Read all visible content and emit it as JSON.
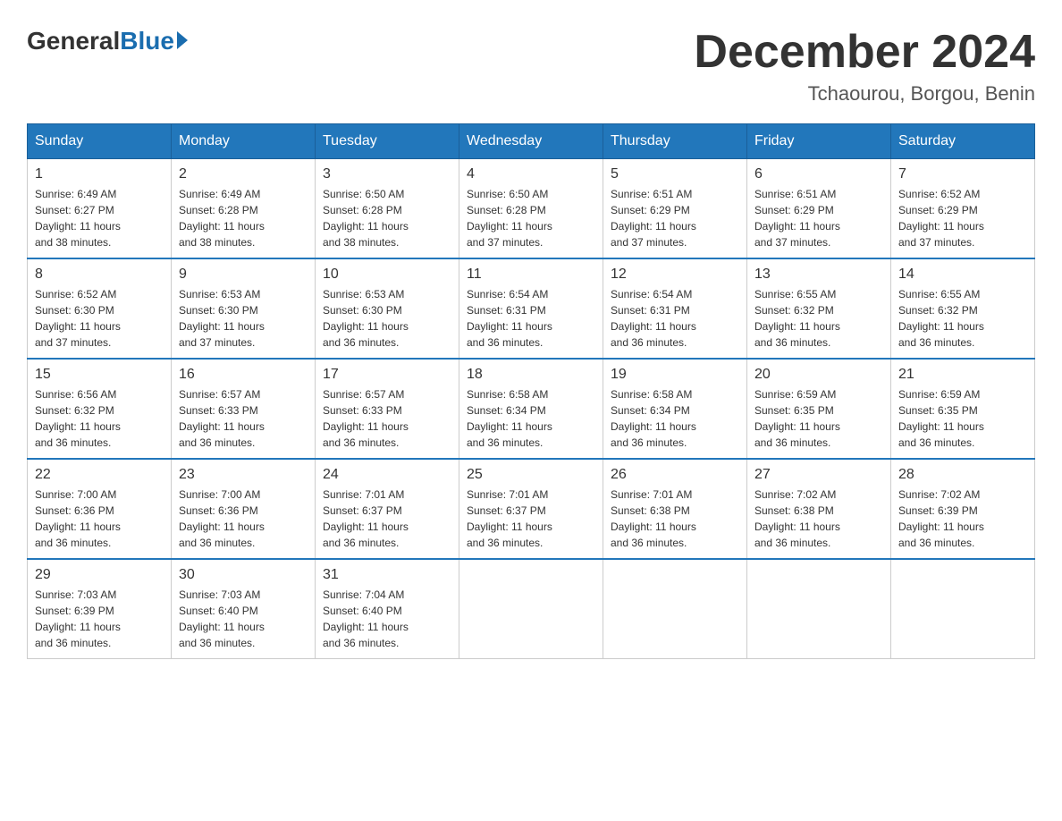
{
  "logo": {
    "general": "General",
    "blue": "Blue"
  },
  "title": "December 2024",
  "location": "Tchaourou, Borgou, Benin",
  "weekdays": [
    "Sunday",
    "Monday",
    "Tuesday",
    "Wednesday",
    "Thursday",
    "Friday",
    "Saturday"
  ],
  "weeks": [
    [
      {
        "day": "1",
        "sunrise": "6:49 AM",
        "sunset": "6:27 PM",
        "daylight": "11 hours and 38 minutes."
      },
      {
        "day": "2",
        "sunrise": "6:49 AM",
        "sunset": "6:28 PM",
        "daylight": "11 hours and 38 minutes."
      },
      {
        "day": "3",
        "sunrise": "6:50 AM",
        "sunset": "6:28 PM",
        "daylight": "11 hours and 38 minutes."
      },
      {
        "day": "4",
        "sunrise": "6:50 AM",
        "sunset": "6:28 PM",
        "daylight": "11 hours and 37 minutes."
      },
      {
        "day": "5",
        "sunrise": "6:51 AM",
        "sunset": "6:29 PM",
        "daylight": "11 hours and 37 minutes."
      },
      {
        "day": "6",
        "sunrise": "6:51 AM",
        "sunset": "6:29 PM",
        "daylight": "11 hours and 37 minutes."
      },
      {
        "day": "7",
        "sunrise": "6:52 AM",
        "sunset": "6:29 PM",
        "daylight": "11 hours and 37 minutes."
      }
    ],
    [
      {
        "day": "8",
        "sunrise": "6:52 AM",
        "sunset": "6:30 PM",
        "daylight": "11 hours and 37 minutes."
      },
      {
        "day": "9",
        "sunrise": "6:53 AM",
        "sunset": "6:30 PM",
        "daylight": "11 hours and 37 minutes."
      },
      {
        "day": "10",
        "sunrise": "6:53 AM",
        "sunset": "6:30 PM",
        "daylight": "11 hours and 36 minutes."
      },
      {
        "day": "11",
        "sunrise": "6:54 AM",
        "sunset": "6:31 PM",
        "daylight": "11 hours and 36 minutes."
      },
      {
        "day": "12",
        "sunrise": "6:54 AM",
        "sunset": "6:31 PM",
        "daylight": "11 hours and 36 minutes."
      },
      {
        "day": "13",
        "sunrise": "6:55 AM",
        "sunset": "6:32 PM",
        "daylight": "11 hours and 36 minutes."
      },
      {
        "day": "14",
        "sunrise": "6:55 AM",
        "sunset": "6:32 PM",
        "daylight": "11 hours and 36 minutes."
      }
    ],
    [
      {
        "day": "15",
        "sunrise": "6:56 AM",
        "sunset": "6:32 PM",
        "daylight": "11 hours and 36 minutes."
      },
      {
        "day": "16",
        "sunrise": "6:57 AM",
        "sunset": "6:33 PM",
        "daylight": "11 hours and 36 minutes."
      },
      {
        "day": "17",
        "sunrise": "6:57 AM",
        "sunset": "6:33 PM",
        "daylight": "11 hours and 36 minutes."
      },
      {
        "day": "18",
        "sunrise": "6:58 AM",
        "sunset": "6:34 PM",
        "daylight": "11 hours and 36 minutes."
      },
      {
        "day": "19",
        "sunrise": "6:58 AM",
        "sunset": "6:34 PM",
        "daylight": "11 hours and 36 minutes."
      },
      {
        "day": "20",
        "sunrise": "6:59 AM",
        "sunset": "6:35 PM",
        "daylight": "11 hours and 36 minutes."
      },
      {
        "day": "21",
        "sunrise": "6:59 AM",
        "sunset": "6:35 PM",
        "daylight": "11 hours and 36 minutes."
      }
    ],
    [
      {
        "day": "22",
        "sunrise": "7:00 AM",
        "sunset": "6:36 PM",
        "daylight": "11 hours and 36 minutes."
      },
      {
        "day": "23",
        "sunrise": "7:00 AM",
        "sunset": "6:36 PM",
        "daylight": "11 hours and 36 minutes."
      },
      {
        "day": "24",
        "sunrise": "7:01 AM",
        "sunset": "6:37 PM",
        "daylight": "11 hours and 36 minutes."
      },
      {
        "day": "25",
        "sunrise": "7:01 AM",
        "sunset": "6:37 PM",
        "daylight": "11 hours and 36 minutes."
      },
      {
        "day": "26",
        "sunrise": "7:01 AM",
        "sunset": "6:38 PM",
        "daylight": "11 hours and 36 minutes."
      },
      {
        "day": "27",
        "sunrise": "7:02 AM",
        "sunset": "6:38 PM",
        "daylight": "11 hours and 36 minutes."
      },
      {
        "day": "28",
        "sunrise": "7:02 AM",
        "sunset": "6:39 PM",
        "daylight": "11 hours and 36 minutes."
      }
    ],
    [
      {
        "day": "29",
        "sunrise": "7:03 AM",
        "sunset": "6:39 PM",
        "daylight": "11 hours and 36 minutes."
      },
      {
        "day": "30",
        "sunrise": "7:03 AM",
        "sunset": "6:40 PM",
        "daylight": "11 hours and 36 minutes."
      },
      {
        "day": "31",
        "sunrise": "7:04 AM",
        "sunset": "6:40 PM",
        "daylight": "11 hours and 36 minutes."
      },
      null,
      null,
      null,
      null
    ]
  ]
}
